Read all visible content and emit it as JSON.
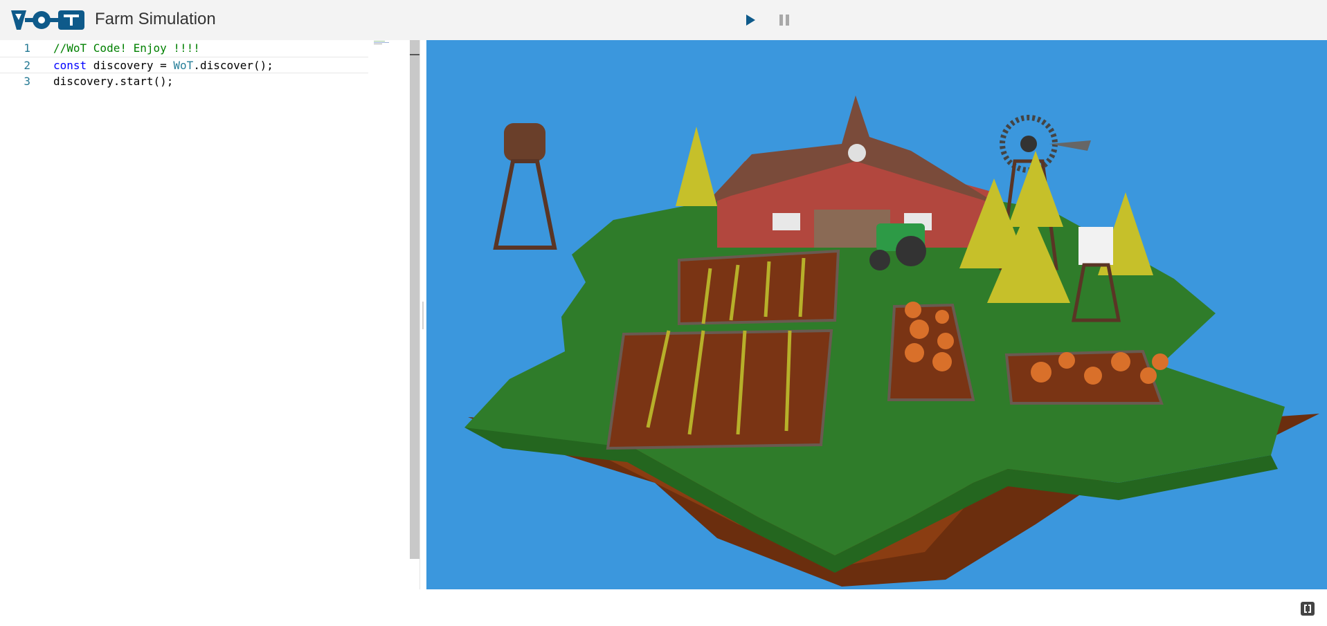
{
  "app": {
    "title": "Farm Simulation",
    "logo": "WoT logo"
  },
  "controls": {
    "play": "play-icon",
    "pause": "pause-icon"
  },
  "editor": {
    "lines": [
      {
        "num": "1",
        "tokens": [
          {
            "t": "//WoT·Code!·Enjoy·!!!!",
            "cls": "c-comment"
          }
        ]
      },
      {
        "num": "2",
        "tokens": [
          {
            "t": "const",
            "cls": "c-kw"
          },
          {
            "t": "·discovery·=·",
            "cls": "c-plain"
          },
          {
            "t": "WoT",
            "cls": "c-type"
          },
          {
            "t": ".discover();",
            "cls": "c-plain"
          }
        ]
      },
      {
        "num": "3",
        "tokens": [
          {
            "t": "discovery.start();",
            "cls": "c-plain"
          }
        ]
      }
    ]
  },
  "scene": {
    "name": "3D farm island",
    "background": "#3b97dd"
  },
  "footer": {
    "icon": "expand-icon"
  }
}
